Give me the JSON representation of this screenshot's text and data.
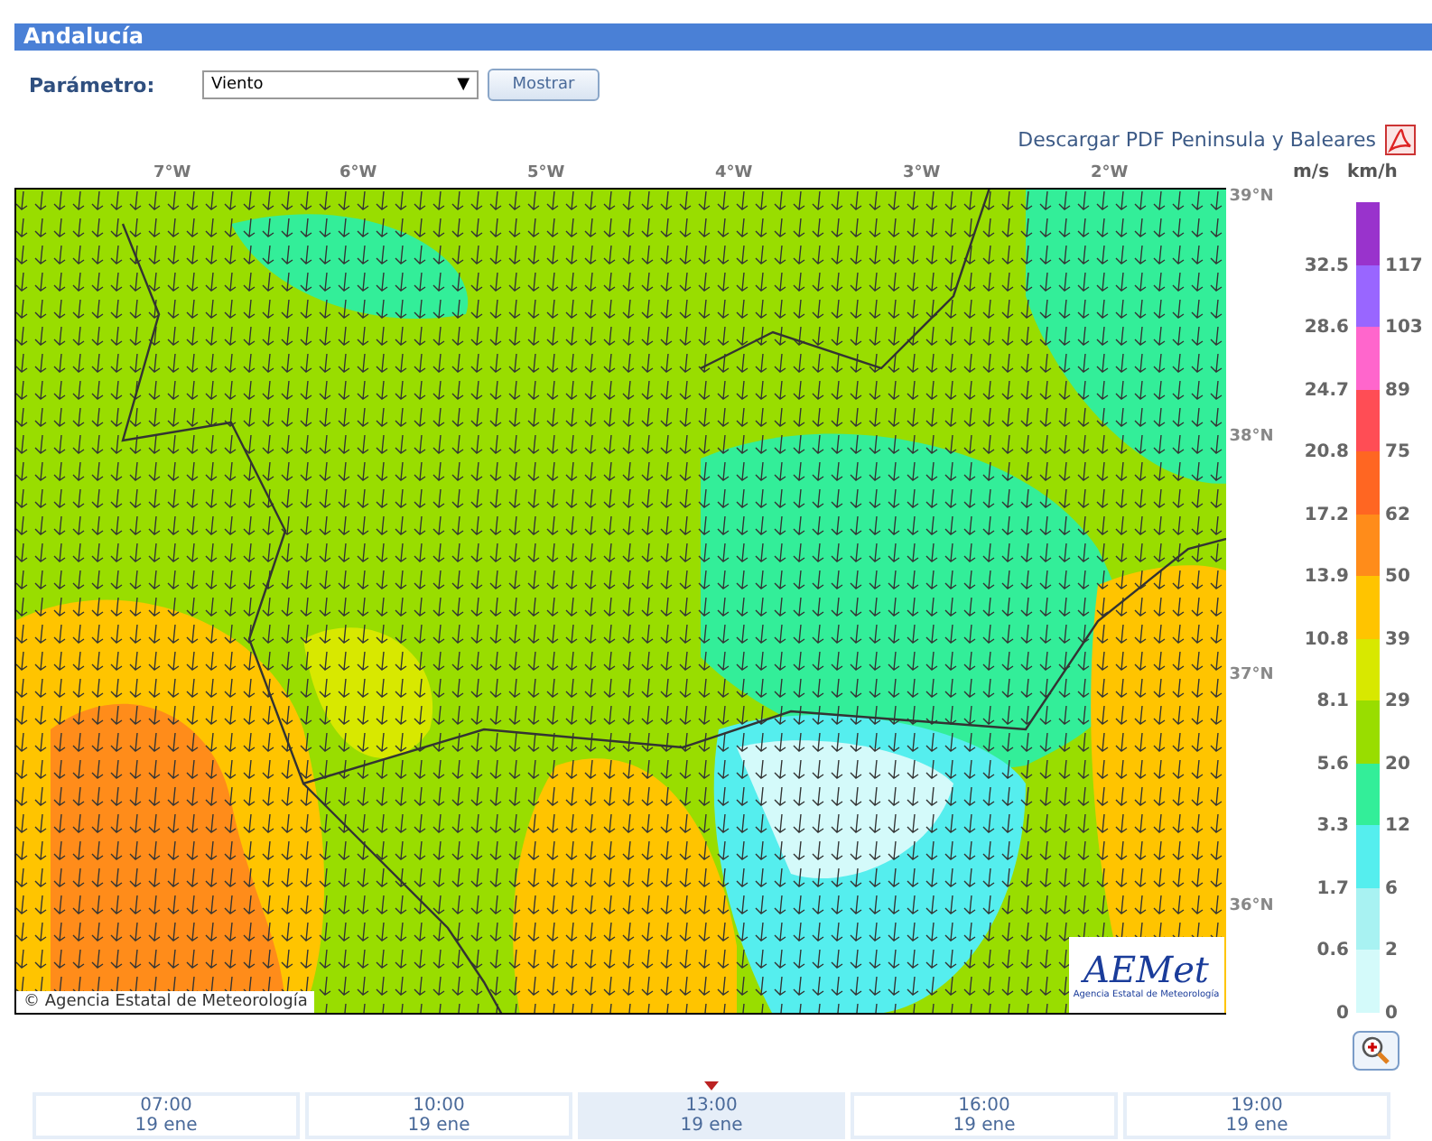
{
  "header": {
    "title": "Andalucía"
  },
  "parameter": {
    "label": "Parámetro:",
    "value": "Viento",
    "caret": "▼",
    "button": "Mostrar"
  },
  "download_link": "Descargar PDF Peninsula y Baleares",
  "map": {
    "longitudes": [
      "7°W",
      "6°W",
      "5°W",
      "4°W",
      "3°W",
      "2°W"
    ],
    "latitudes": [
      "39°N",
      "38°N",
      "37°N",
      "36°N"
    ],
    "copyright_symbol": "©",
    "credit": "Agencia Estatal de Meteorología",
    "logo_text": "AEMet",
    "logo_caption": "Agencia Estatal de Meteorología"
  },
  "legend": {
    "unit_ms": "m/s",
    "unit_kmh": "km/h",
    "bands": [
      {
        "color": "#9933cc",
        "ms": "32.5",
        "kmh": "117"
      },
      {
        "color": "#9966ff",
        "ms": "28.6",
        "kmh": "103"
      },
      {
        "color": "#ff66cc",
        "ms": "24.7",
        "kmh": "89"
      },
      {
        "color": "#ff4d55",
        "ms": "20.8",
        "kmh": "75"
      },
      {
        "color": "#ff6622",
        "ms": "17.2",
        "kmh": "62"
      },
      {
        "color": "#ff8c1a",
        "ms": "13.9",
        "kmh": "50"
      },
      {
        "color": "#ffc400",
        "ms": "10.8",
        "kmh": "39"
      },
      {
        "color": "#d8e800",
        "ms": "8.1",
        "kmh": "29"
      },
      {
        "color": "#99dd00",
        "ms": "5.6",
        "kmh": "20"
      },
      {
        "color": "#33ee99",
        "ms": "3.3",
        "kmh": "12"
      },
      {
        "color": "#55eeee",
        "ms": "1.7",
        "kmh": "6"
      },
      {
        "color": "#a8f2f2",
        "ms": "0.6",
        "kmh": "2"
      },
      {
        "color": "#d4fafa",
        "ms": "0",
        "kmh": "0"
      }
    ]
  },
  "times": [
    {
      "time": "07:00",
      "date": "19 ene",
      "selected": false
    },
    {
      "time": "10:00",
      "date": "19 ene",
      "selected": false
    },
    {
      "time": "13:00",
      "date": "19 ene",
      "selected": true
    },
    {
      "time": "16:00",
      "date": "19 ene",
      "selected": false
    },
    {
      "time": "19:00",
      "date": "19 ene",
      "selected": false
    }
  ]
}
